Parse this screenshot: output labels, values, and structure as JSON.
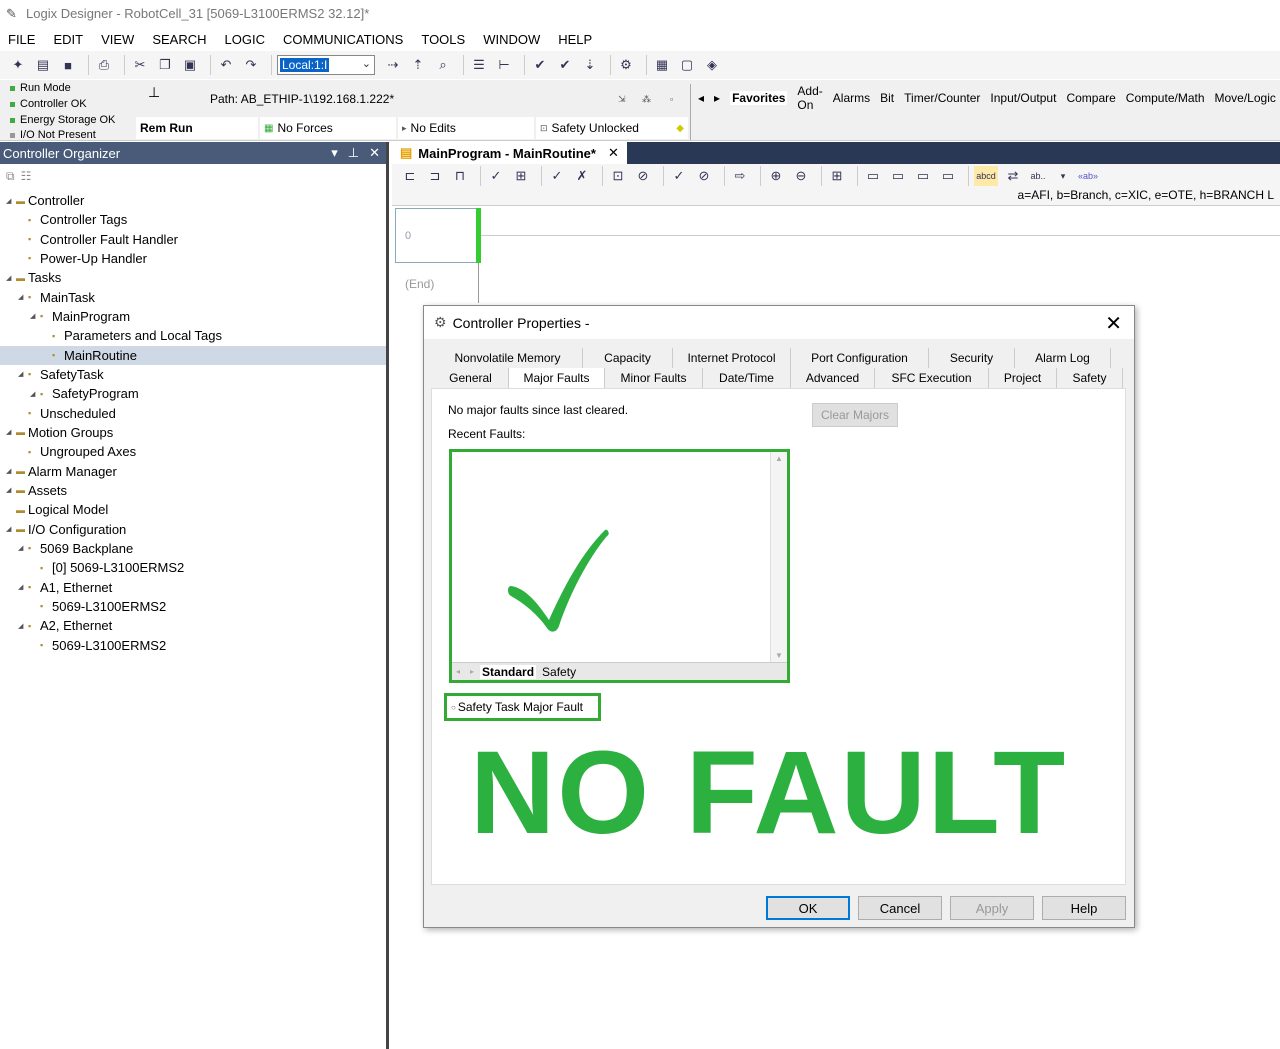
{
  "window": {
    "title": "Logix Designer - RobotCell_31 [5069-L3100ERMS2 32.12]*"
  },
  "menu": [
    "FILE",
    "EDIT",
    "VIEW",
    "SEARCH",
    "LOGIC",
    "COMMUNICATIONS",
    "TOOLS",
    "WINDOW",
    "HELP"
  ],
  "toolbar": {
    "path_combo_value": "Local:1:I"
  },
  "status": {
    "lines": [
      "Run Mode",
      "Controller OK",
      "Energy Storage OK",
      "I/O Not Present"
    ],
    "path": "Path:  AB_ETHIP-1\\192.168.1.222*",
    "mode": "Rem Run",
    "forces": "No Forces",
    "edits": "No Edits",
    "safety": "Safety Unlocked"
  },
  "instruction_tabs": [
    "Favorites",
    "Add-On",
    "Alarms",
    "Bit",
    "Timer/Counter",
    "Input/Output",
    "Compare",
    "Compute/Math",
    "Move/Logic"
  ],
  "organizer": {
    "title": "Controller Organizer",
    "tree": [
      {
        "label": "Controller",
        "level": 0
      },
      {
        "label": "Controller Tags",
        "level": 1
      },
      {
        "label": "Controller Fault Handler",
        "level": 1
      },
      {
        "label": "Power-Up Handler",
        "level": 1
      },
      {
        "label": "Tasks",
        "level": 0
      },
      {
        "label": "MainTask",
        "level": 1
      },
      {
        "label": "MainProgram",
        "level": 2
      },
      {
        "label": "Parameters and Local Tags",
        "level": 3
      },
      {
        "label": "MainRoutine",
        "level": 3
      },
      {
        "label": "SafetyTask",
        "level": 1
      },
      {
        "label": "SafetyProgram",
        "level": 2
      },
      {
        "label": "Unscheduled",
        "level": 1
      },
      {
        "label": "Motion Groups",
        "level": 0
      },
      {
        "label": "Ungrouped Axes",
        "level": 1
      },
      {
        "label": "Alarm Manager",
        "level": 0
      },
      {
        "label": "Assets",
        "level": 0
      },
      {
        "label": "Logical Model",
        "level": 0
      },
      {
        "label": "I/O Configuration",
        "level": 0
      },
      {
        "label": "5069 Backplane",
        "level": 1
      },
      {
        "label": "[0] 5069-L3100ERMS2",
        "level": 2
      },
      {
        "label": "A1, Ethernet",
        "level": 1
      },
      {
        "label": "5069-L3100ERMS2",
        "level": 2
      },
      {
        "label": "A2, Ethernet",
        "level": 1
      },
      {
        "label": "5069-L3100ERMS2",
        "level": 2
      }
    ]
  },
  "editor": {
    "tab_title": "MainProgram - MainRoutine*",
    "hint": "a=AFI, b=Branch, c=XIC, e=OTE, h=BRANCH L",
    "rung_number": "0",
    "end_label": "(End)"
  },
  "dialog": {
    "title": "Controller Properties -",
    "tabs_row1": [
      "Nonvolatile Memory",
      "Capacity",
      "Internet Protocol",
      "Port Configuration",
      "Security",
      "Alarm Log"
    ],
    "tabs_row2": [
      "General",
      "Major Faults",
      "Minor Faults",
      "Date/Time",
      "Advanced",
      "SFC Execution",
      "Project",
      "Safety"
    ],
    "message": "No major faults since last cleared.",
    "clear_button": "Clear Majors",
    "recent_label": "Recent Faults:",
    "recent_tabs": [
      "Standard",
      "Safety"
    ],
    "safety_fault_label": "Safety Task Major Fault",
    "overlay_text": "NO FAULT",
    "buttons": {
      "ok": "OK",
      "cancel": "Cancel",
      "apply": "Apply",
      "help": "Help"
    }
  }
}
